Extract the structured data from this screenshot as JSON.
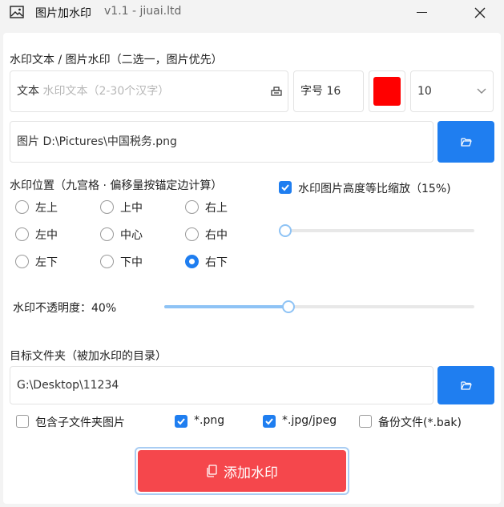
{
  "window": {
    "title": "图片加水印",
    "version": "v1.1 - jiuai.ltd"
  },
  "watermark_source": {
    "section_label": "水印文本 / 图片水印（二选一，图片优先）",
    "text_label": "文本",
    "text_placeholder": "水印文本（2-30个汉字）",
    "font_size_label": "字号",
    "font_size_value": "16",
    "color": "#ff0000",
    "count_select_value": "10",
    "image_label": "图片",
    "image_path": "D:\\Pictures\\中国税务.png"
  },
  "position": {
    "section_label": "水印位置（九宫格 · 偏移量按锚定边计算）",
    "options": [
      "左上",
      "上中",
      "右上",
      "左中",
      "中心",
      "右中",
      "左下",
      "下中",
      "右下"
    ],
    "selected": "右下"
  },
  "scale": {
    "label": "水印图片高度等比缩放（15%)",
    "checked": true,
    "value_percent": 2
  },
  "opacity": {
    "label": "水印不透明度：40%",
    "value_percent": 40
  },
  "target": {
    "section_label": "目标文件夹（被加水印的目录）",
    "path": "G:\\Desktop\\11234"
  },
  "filters": [
    {
      "label": "包含子文件夹图片",
      "checked": false
    },
    {
      "label": "*.png",
      "checked": true
    },
    {
      "label": "*.jpg/jpeg",
      "checked": true
    },
    {
      "label": "备份文件(*.bak)",
      "checked": false
    }
  ],
  "action": {
    "label": "添加水印",
    "color": "#f5474c"
  },
  "accent_color": "#1f7ef0"
}
